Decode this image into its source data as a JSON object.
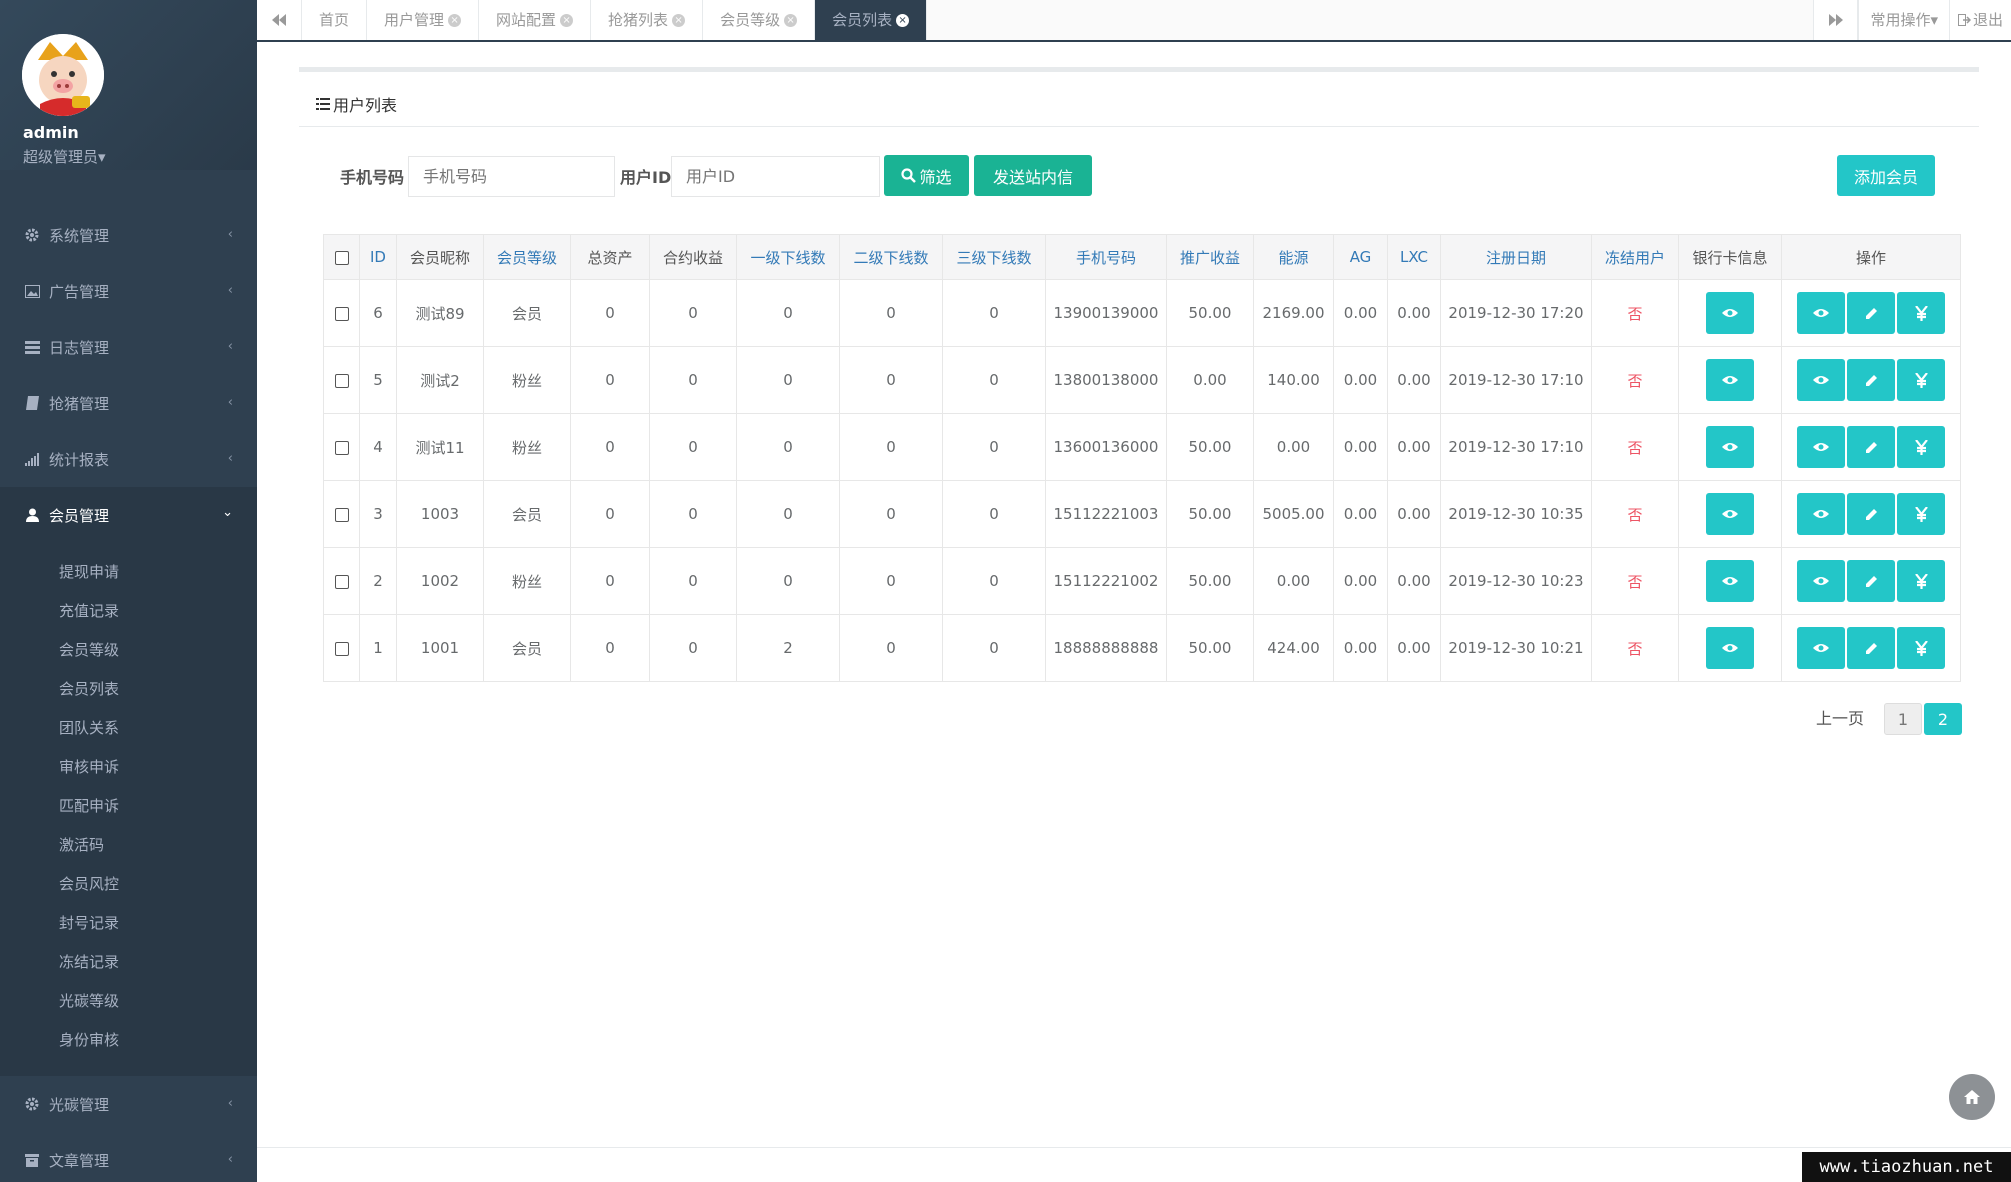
{
  "user": {
    "name": "admin",
    "role": "超级管理员▾"
  },
  "nav": {
    "items": [
      {
        "label": "系统管理",
        "icon": "gear-icon"
      },
      {
        "label": "广告管理",
        "icon": "image-icon"
      },
      {
        "label": "日志管理",
        "icon": "list-icon"
      },
      {
        "label": "抢猪管理",
        "icon": "book-icon"
      },
      {
        "label": "统计报表",
        "icon": "signal-icon"
      },
      {
        "label": "会员管理",
        "icon": "user-icon",
        "active": true
      }
    ],
    "sub_items": [
      "提现申请",
      "充值记录",
      "会员等级",
      "会员列表",
      "团队关系",
      "审核申诉",
      "匹配申诉",
      "激活码",
      "会员风控",
      "封号记录",
      "冻结记录",
      "光碳等级",
      "身份审核"
    ],
    "bottom_items": [
      {
        "label": "光碳管理",
        "icon": "gear-icon"
      },
      {
        "label": "文章管理",
        "icon": "archive-icon"
      }
    ]
  },
  "tabs": [
    "首页",
    "用户管理",
    "网站配置",
    "抢猪列表",
    "会员等级",
    "会员列表"
  ],
  "topbar": {
    "common_ops": "常用操作▾",
    "logout": "退出"
  },
  "page": {
    "title": "用户列表",
    "filter": {
      "phone_label": "手机号码",
      "phone_placeholder": "手机号码",
      "uid_label": "用户ID",
      "uid_placeholder": "用户ID",
      "filter_btn": "筛选",
      "send_btn": "发送站内信",
      "add_btn": "添加会员"
    }
  },
  "table": {
    "headers": [
      "ID",
      "会员昵称",
      "会员等级",
      "总资产",
      "合约收益",
      "一级下线数",
      "二级下线数",
      "三级下线数",
      "手机号码",
      "推广收益",
      "能源",
      "AG",
      "LXC",
      "注册日期",
      "冻结用户",
      "银行卡信息",
      "操作"
    ],
    "rows": [
      [
        "6",
        "测试89",
        "会员",
        "0",
        "0",
        "0",
        "0",
        "0",
        "13900139000",
        "50.00",
        "2169.00",
        "0.00",
        "0.00",
        "2019-12-30 17:20",
        "否"
      ],
      [
        "5",
        "测试2",
        "粉丝",
        "0",
        "0",
        "0",
        "0",
        "0",
        "13800138000",
        "0.00",
        "140.00",
        "0.00",
        "0.00",
        "2019-12-30 17:10",
        "否"
      ],
      [
        "4",
        "测试11",
        "粉丝",
        "0",
        "0",
        "0",
        "0",
        "0",
        "13600136000",
        "50.00",
        "0.00",
        "0.00",
        "0.00",
        "2019-12-30 17:10",
        "否"
      ],
      [
        "3",
        "1003",
        "会员",
        "0",
        "0",
        "0",
        "0",
        "0",
        "15112221003",
        "50.00",
        "5005.00",
        "0.00",
        "0.00",
        "2019-12-30 10:35",
        "否"
      ],
      [
        "2",
        "1002",
        "粉丝",
        "0",
        "0",
        "0",
        "0",
        "0",
        "15112221002",
        "50.00",
        "0.00",
        "0.00",
        "0.00",
        "2019-12-30 10:23",
        "否"
      ],
      [
        "1",
        "1001",
        "会员",
        "0",
        "0",
        "2",
        "0",
        "0",
        "18888888888",
        "50.00",
        "424.00",
        "0.00",
        "0.00",
        "2019-12-30 10:21",
        "否"
      ]
    ]
  },
  "pagination": {
    "prev": "上一页",
    "pages": [
      "1",
      "2"
    ],
    "current": "2"
  },
  "watermark": "www.tiaozhuan.net",
  "colors": {
    "sidebar": "#2f4050",
    "primary": "#1ab394",
    "info": "#23c6c8",
    "danger": "#ed5565",
    "link": "#337ab7"
  }
}
